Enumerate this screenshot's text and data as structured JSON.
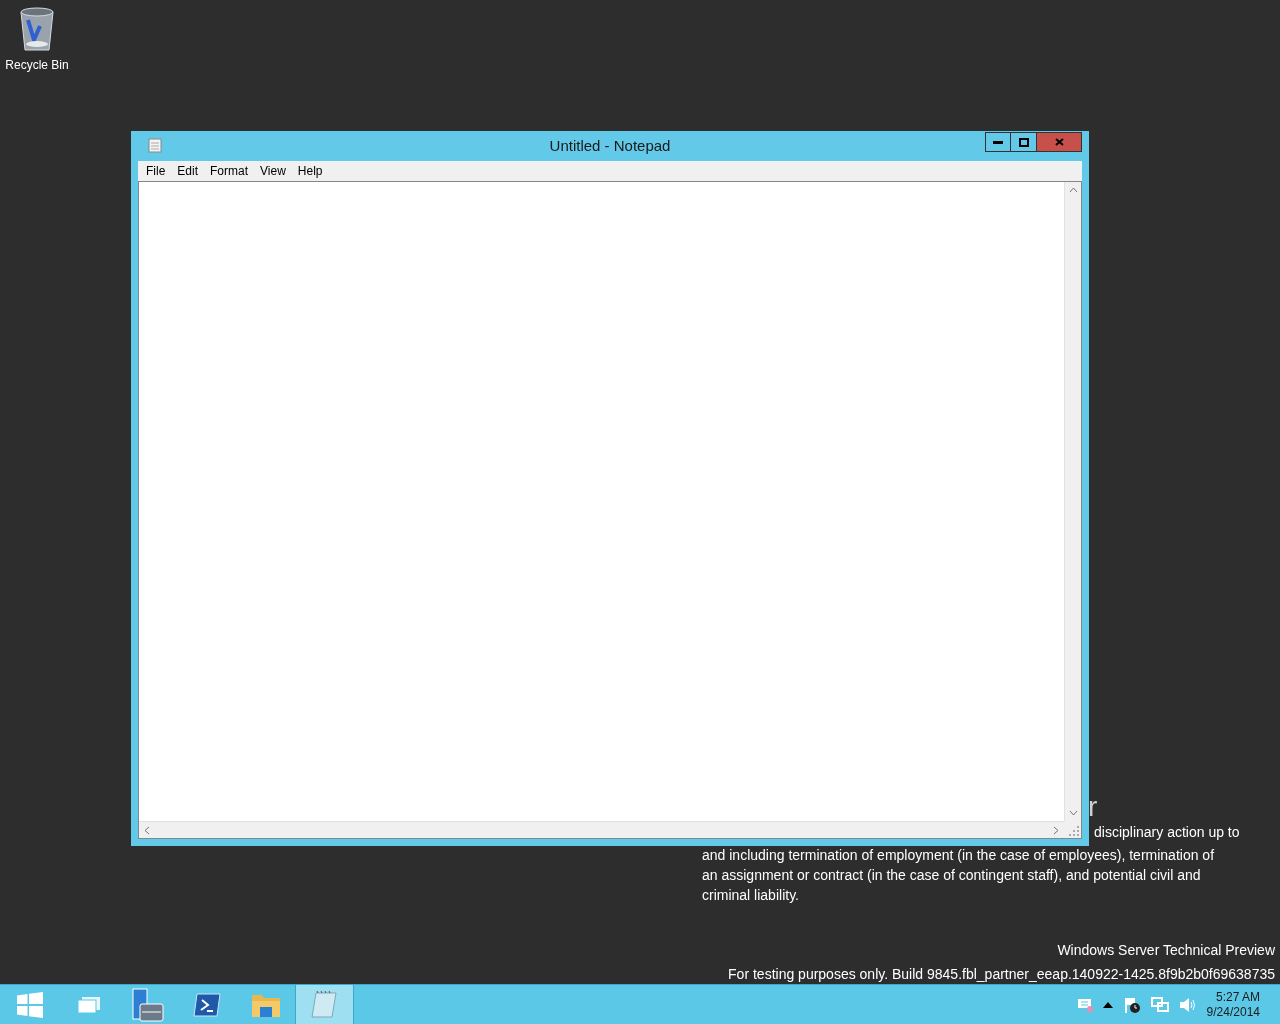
{
  "desktop_icons": [
    {
      "label": "Recycle Bin"
    }
  ],
  "window": {
    "title": "Untitled - Notepad",
    "menu": [
      "File",
      "Edit",
      "Format",
      "View",
      "Help"
    ]
  },
  "notice": {
    "heading": "r",
    "lines": [
      "disciplinary action up to",
      "and including termination of employment (in the case of employees), termination of",
      "an assignment or contract (in the case of contingent staff), and potential civil and",
      "criminal liability."
    ]
  },
  "branding": {
    "edition": "Windows Server Technical Preview",
    "build": "For testing purposes only. Build 9845.fbl_partner_eeap.140922-1425.8f9b2b0f69638735"
  },
  "taskbar": {
    "items": [
      {
        "kind": "start",
        "selected": false
      },
      {
        "kind": "taskview",
        "selected": false
      },
      {
        "kind": "servermanager",
        "selected": false
      },
      {
        "kind": "powershell",
        "selected": false
      },
      {
        "kind": "explorer",
        "selected": false
      },
      {
        "kind": "notepad",
        "selected": true
      }
    ],
    "tray": {
      "time": "5:27 AM",
      "date": "9/24/2014"
    }
  }
}
